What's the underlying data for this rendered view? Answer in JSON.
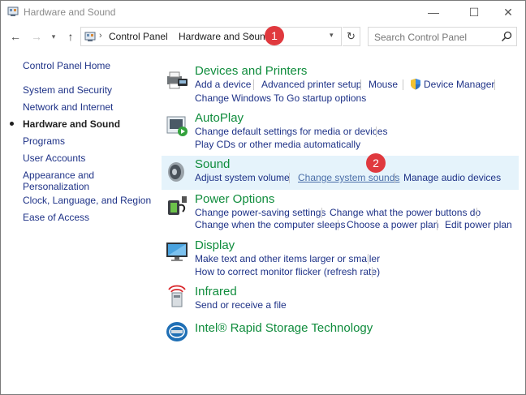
{
  "window": {
    "title": "Hardware and Sound",
    "minimize_glyph": "—",
    "maximize_glyph": "☐",
    "close_glyph": "✕"
  },
  "nav": {
    "back_glyph": "←",
    "forward_glyph": "→",
    "recent_glyph": "▾",
    "up_glyph": "↑",
    "separator_glyph": "›",
    "dropdown_glyph": "▾",
    "refresh_glyph": "↻",
    "breadcrumb": [
      "Control Panel",
      "Hardware and Sound"
    ],
    "search_placeholder": "Search Control Panel"
  },
  "sidebar": {
    "home": "Control Panel Home",
    "items": [
      {
        "label": "System and Security",
        "current": false
      },
      {
        "label": "Network and Internet",
        "current": false
      },
      {
        "label": "Hardware and Sound",
        "current": true
      },
      {
        "label": "Programs",
        "current": false
      },
      {
        "label": "User Accounts",
        "current": false
      },
      {
        "label": "Appearance and Personalization",
        "current": false
      },
      {
        "label": "Clock, Language, and Region",
        "current": false
      },
      {
        "label": "Ease of Access",
        "current": false
      }
    ]
  },
  "categories": [
    {
      "title": "Devices and Printers",
      "icon": "printer-icon",
      "tasks": [
        "Add a device",
        "Advanced printer setup",
        "Mouse",
        "Device Manager",
        "Change Windows To Go startup options"
      ]
    },
    {
      "title": "AutoPlay",
      "icon": "autoplay-icon",
      "tasks": [
        "Change default settings for media or devices",
        "Play CDs or other media automatically"
      ]
    },
    {
      "title": "Sound",
      "icon": "speaker-icon",
      "tasks": [
        "Adjust system volume",
        "Change system sounds",
        "Manage audio devices"
      ]
    },
    {
      "title": "Power Options",
      "icon": "power-icon",
      "tasks": [
        "Change power-saving settings",
        "Change what the power buttons do",
        "Change when the computer sleeps",
        "Choose a power plan",
        "Edit power plan"
      ]
    },
    {
      "title": "Display",
      "icon": "monitor-icon",
      "tasks": [
        "Make text and other items larger or smaller",
        "How to correct monitor flicker (refresh rate)"
      ]
    },
    {
      "title": "Infrared",
      "icon": "infrared-icon",
      "tasks": [
        "Send or receive a file"
      ]
    },
    {
      "title": "Intel® Rapid Storage Technology",
      "icon": "intel-storage-icon",
      "tasks": []
    }
  ],
  "annotations": [
    "1",
    "2"
  ],
  "colors": {
    "link": "#1e3287",
    "category_title": "#0f8c3c",
    "highlight": "#e5f3fb",
    "badge": "#e0393e"
  }
}
